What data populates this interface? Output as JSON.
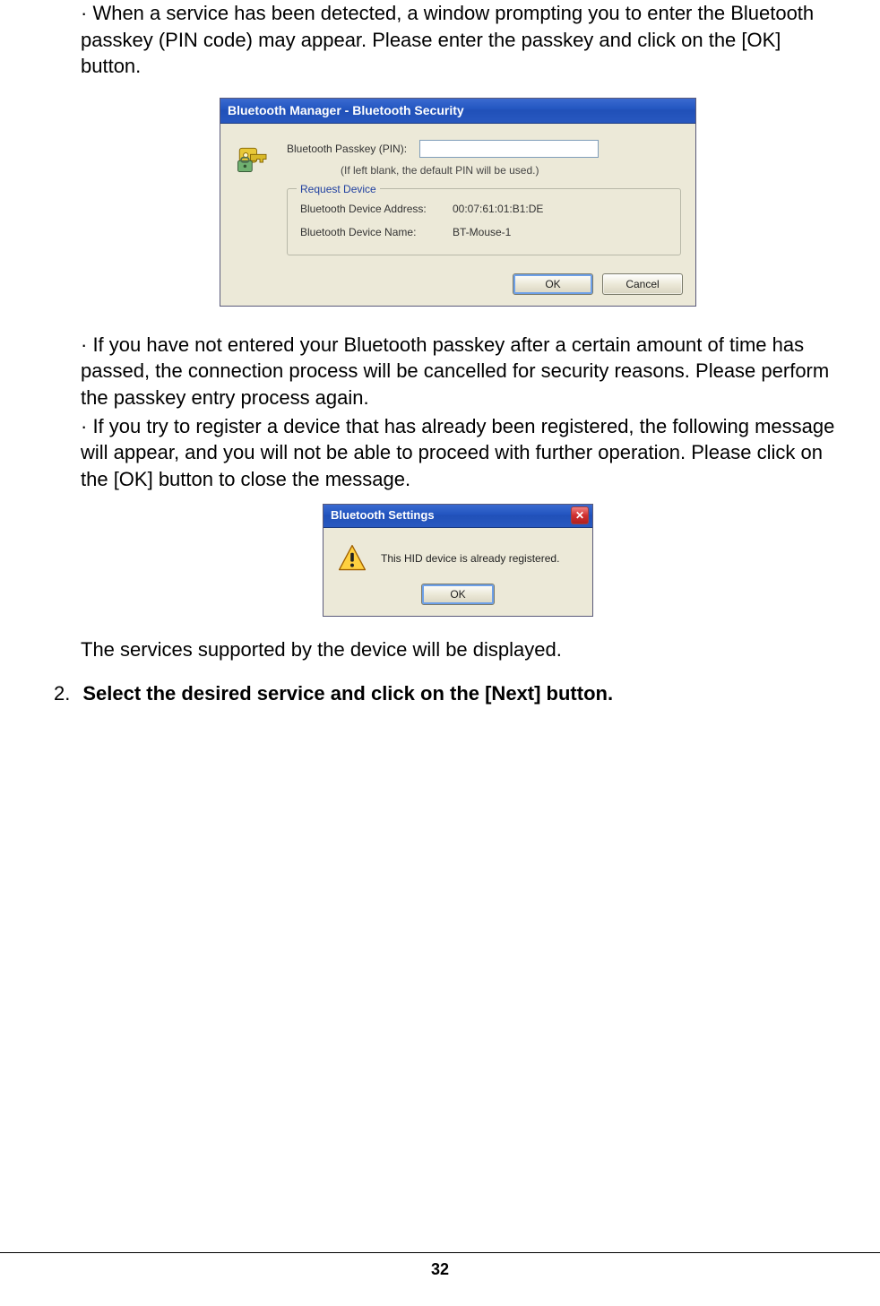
{
  "para1": "· When a service has been detected, a window prompting you to enter the Bluetooth passkey (PIN code) may appear. Please enter the passkey and click on the [OK] button.",
  "dialog1": {
    "title": "Bluetooth Manager - Bluetooth Security",
    "passkeyLabel": "Bluetooth Passkey (PIN):",
    "hint": "(If left blank, the default PIN will be used.)",
    "fieldsetLegend": "Request Device",
    "addrLabel": "Bluetooth Device Address:",
    "addrValue": "00:07:61:01:B1:DE",
    "nameLabel": "Bluetooth Device Name:",
    "nameValue": "BT-Mouse-1",
    "okLabel": "OK",
    "cancelLabel": "Cancel"
  },
  "para2": "· If you have not entered your Bluetooth passkey after a certain amount of time has passed, the connection process will be cancelled for security reasons. Please perform the passkey entry process again.",
  "para3": "· If you try to register a device that has already been registered, the following message will appear, and you will not be able to proceed with further operation. Please click on the [OK] button to close the message.",
  "dialog2": {
    "title": "Bluetooth Settings",
    "message": "This HID device is already registered.",
    "okLabel": "OK",
    "closeSymbol": "✕"
  },
  "para4": "The services supported by the device will be displayed.",
  "step": {
    "num": "2.",
    "text": "Select the desired service and click on the [Next] button."
  },
  "pageNumber": "32"
}
